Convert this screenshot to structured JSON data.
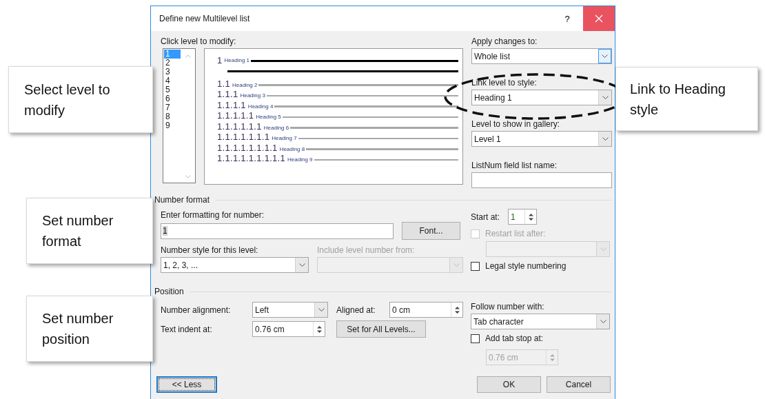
{
  "window": {
    "title": "Define new Multilevel list",
    "help": "?"
  },
  "level_panel": {
    "label": "Click level to modify:",
    "levels": [
      {
        "label": "1",
        "selected": true
      },
      {
        "label": "2",
        "selected": false
      },
      {
        "label": "3",
        "selected": false
      },
      {
        "label": "4",
        "selected": false
      },
      {
        "label": "5",
        "selected": false
      },
      {
        "label": "6",
        "selected": false
      },
      {
        "label": "7",
        "selected": false
      },
      {
        "label": "8",
        "selected": false
      },
      {
        "label": "9",
        "selected": false
      }
    ]
  },
  "preview": {
    "rows": [
      {
        "number": "1",
        "text": "Heading 1",
        "kind": "current"
      },
      {
        "number": "1.1",
        "text": "Heading 2",
        "kind": "other"
      },
      {
        "number": "1.1.1",
        "text": "Heading 3",
        "kind": "other"
      },
      {
        "number": "1.1.1.1",
        "text": "Heading 4",
        "kind": "other"
      },
      {
        "number": "1.1.1.1.1",
        "text": "Heading 5",
        "kind": "other"
      },
      {
        "number": "1.1.1.1.1.1",
        "text": "Heading 6",
        "kind": "other"
      },
      {
        "number": "1.1.1.1.1.1.1",
        "text": "Heading 7",
        "kind": "other"
      },
      {
        "number": "1.1.1.1.1.1.1.1",
        "text": "Heading 8",
        "kind": "other"
      },
      {
        "number": "1.1.1.1.1.1.1.1.1",
        "text": "Heading 9",
        "kind": "other"
      }
    ]
  },
  "apply_changes": {
    "label": "Apply changes to:",
    "value": "Whole list"
  },
  "link_level": {
    "label": "Link level to style:",
    "value": "Heading 1"
  },
  "gallery_level": {
    "label": "Level to show in gallery:",
    "value": "Level 1"
  },
  "listnum": {
    "label": "ListNum field list name:"
  },
  "number_format": {
    "heading": "Number format",
    "format_label": "Enter formatting for number:",
    "format_value": "1",
    "font_button": "Font...",
    "style_label": "Number style for this level:",
    "style_value": "1, 2, 3, ...",
    "include": {
      "label": "Include level number from:",
      "disabled": true
    },
    "start_label": "Start at:",
    "start_value": "1",
    "restart": {
      "label": "Restart list after:",
      "checked": false,
      "disabled": true
    },
    "legal": {
      "label": "Legal style numbering",
      "checked": false,
      "disabled": false
    }
  },
  "position": {
    "heading": "Position",
    "alignment_label": "Number alignment:",
    "alignment_value": "Left",
    "aligned_label": "Aligned at:",
    "aligned_value": "0 cm",
    "indent_label": "Text indent at:",
    "indent_value": "0.76 cm",
    "all_levels_button": "Set for All Levels...",
    "follow_label": "Follow number with:",
    "follow_value": "Tab character",
    "tab_stop": {
      "label": "Add tab stop at:",
      "checked": false,
      "disabled": false
    },
    "tab_stop_value": {
      "value": "0.76 cm",
      "disabled": true
    }
  },
  "buttons": {
    "less": "<< Less",
    "ok": "OK",
    "cancel": "Cancel"
  },
  "callouts": [
    {
      "text": "Select level to modify"
    },
    {
      "text": "Link to Heading style"
    },
    {
      "text": "Set number format"
    },
    {
      "text": "Set number position"
    }
  ]
}
